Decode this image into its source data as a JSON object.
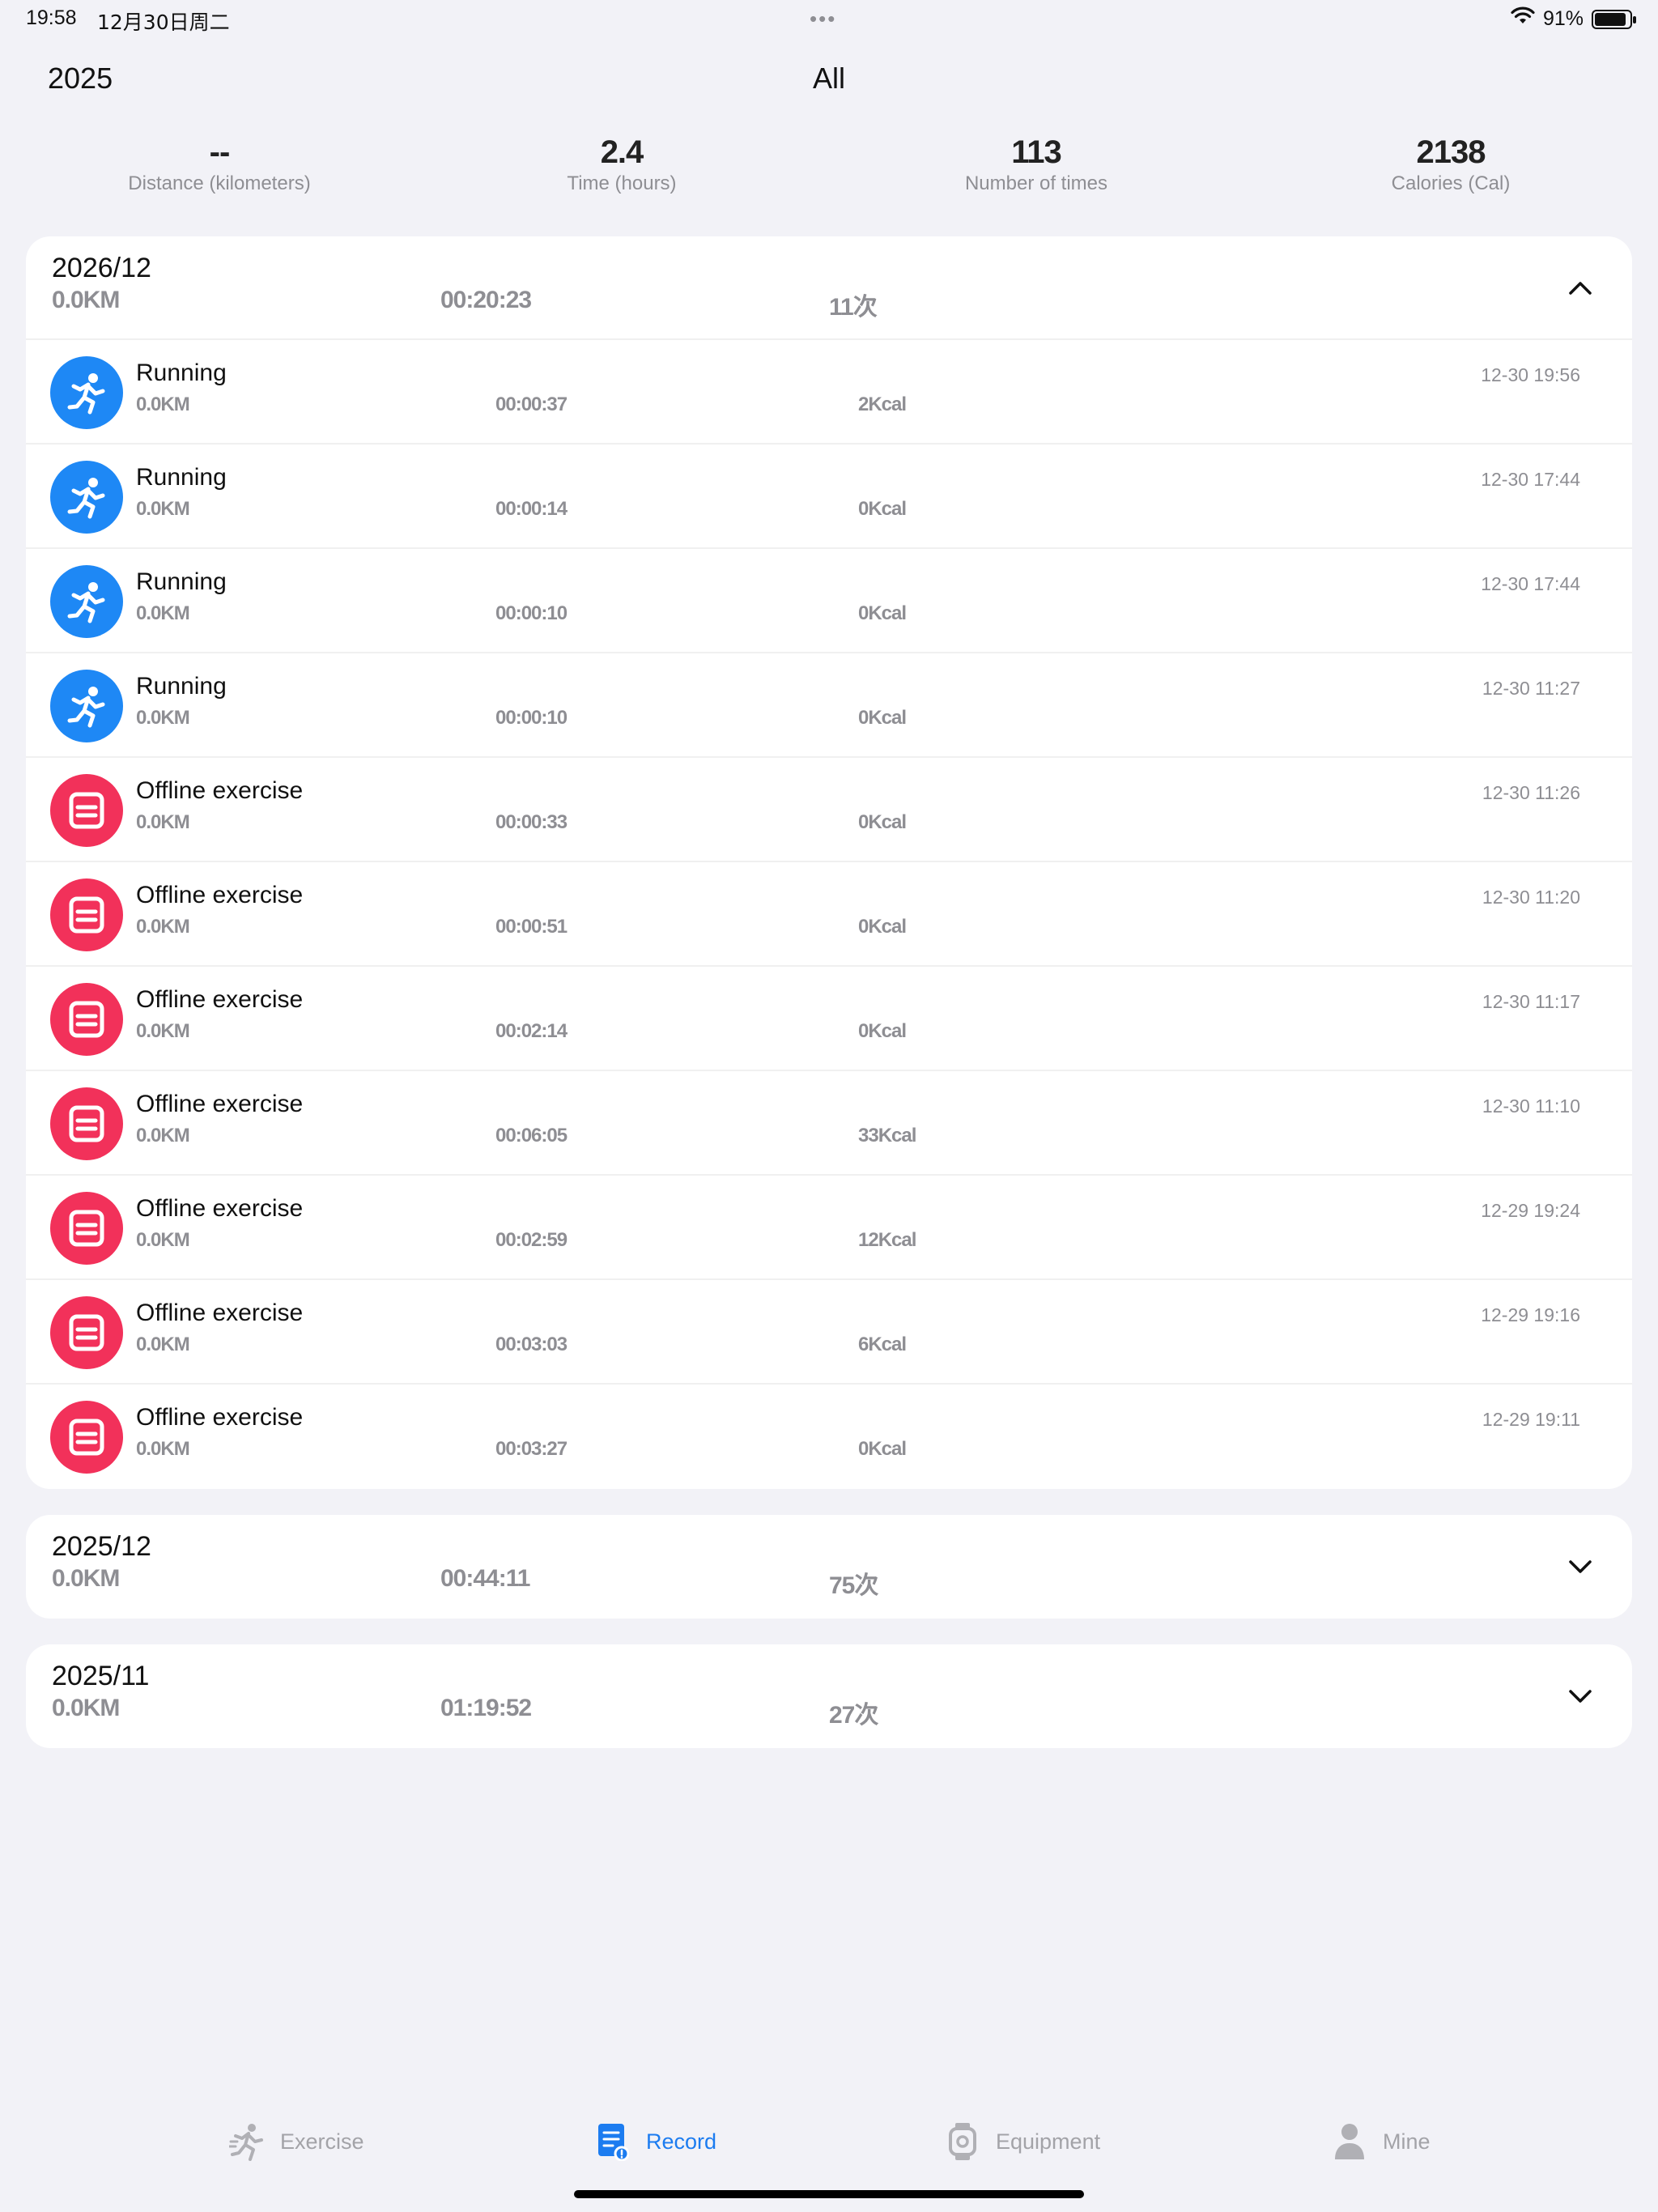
{
  "status_bar": {
    "time": "19:58",
    "date": "12月30日周二",
    "dots": "•••",
    "battery": "91%",
    "battery_fraction": 0.91
  },
  "header": {
    "year": "2025",
    "filter": "All"
  },
  "summary": [
    {
      "value": "--",
      "label": "Distance (kilometers)"
    },
    {
      "value": "2.4",
      "label": "Time (hours)"
    },
    {
      "value": "113",
      "label": "Number of times"
    },
    {
      "value": "2138",
      "label": "Calories (Cal)"
    }
  ],
  "months": [
    {
      "title": "2026/12",
      "km": "0.0KM",
      "time": "00:20:23",
      "count": "11次",
      "expanded": true,
      "records": [
        {
          "type": "run",
          "icon": "running-icon",
          "name": "Running",
          "km": "0.0KM",
          "time": "00:00:37",
          "cal": "2Kcal",
          "date": "12-30 19:56"
        },
        {
          "type": "run",
          "icon": "running-icon",
          "name": "Running",
          "km": "0.0KM",
          "time": "00:00:14",
          "cal": "0Kcal",
          "date": "12-30 17:44"
        },
        {
          "type": "run",
          "icon": "running-icon",
          "name": "Running",
          "km": "0.0KM",
          "time": "00:00:10",
          "cal": "0Kcal",
          "date": "12-30 17:44"
        },
        {
          "type": "run",
          "icon": "running-icon",
          "name": "Running",
          "km": "0.0KM",
          "time": "00:00:10",
          "cal": "0Kcal",
          "date": "12-30 11:27"
        },
        {
          "type": "off",
          "icon": "offline-exercise-icon",
          "name": "Offline exercise",
          "km": "0.0KM",
          "time": "00:00:33",
          "cal": "0Kcal",
          "date": "12-30 11:26"
        },
        {
          "type": "off",
          "icon": "offline-exercise-icon",
          "name": "Offline exercise",
          "km": "0.0KM",
          "time": "00:00:51",
          "cal": "0Kcal",
          "date": "12-30 11:20"
        },
        {
          "type": "off",
          "icon": "offline-exercise-icon",
          "name": "Offline exercise",
          "km": "0.0KM",
          "time": "00:02:14",
          "cal": "0Kcal",
          "date": "12-30 11:17"
        },
        {
          "type": "off",
          "icon": "offline-exercise-icon",
          "name": "Offline exercise",
          "km": "0.0KM",
          "time": "00:06:05",
          "cal": "33Kcal",
          "date": "12-30 11:10"
        },
        {
          "type": "off",
          "icon": "offline-exercise-icon",
          "name": "Offline exercise",
          "km": "0.0KM",
          "time": "00:02:59",
          "cal": "12Kcal",
          "date": "12-29 19:24"
        },
        {
          "type": "off",
          "icon": "offline-exercise-icon",
          "name": "Offline exercise",
          "km": "0.0KM",
          "time": "00:03:03",
          "cal": "6Kcal",
          "date": "12-29 19:16"
        },
        {
          "type": "off",
          "icon": "offline-exercise-icon",
          "name": "Offline exercise",
          "km": "0.0KM",
          "time": "00:03:27",
          "cal": "0Kcal",
          "date": "12-29 19:11"
        }
      ]
    },
    {
      "title": "2025/12",
      "km": "0.0KM",
      "time": "00:44:11",
      "count": "75次",
      "expanded": false,
      "records": []
    },
    {
      "title": "2025/11",
      "km": "0.0KM",
      "time": "01:19:52",
      "count": "27次",
      "expanded": false,
      "records": []
    }
  ],
  "tabs": [
    {
      "label": "Exercise",
      "icon": "exercise-icon",
      "active": false
    },
    {
      "label": "Record",
      "icon": "record-icon",
      "active": true
    },
    {
      "label": "Equipment",
      "icon": "watch-icon",
      "active": false
    },
    {
      "label": "Mine",
      "icon": "person-icon",
      "active": false
    }
  ],
  "colors": {
    "run": "#1e88f5",
    "offline": "#f2315a",
    "active_tab": "#1c7cf0",
    "background": "#f2f2f7"
  }
}
